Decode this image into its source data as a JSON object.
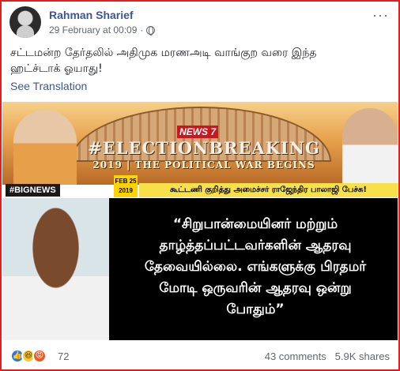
{
  "post": {
    "author": "Rahman Sharief",
    "timestamp": "29 February at 00:09",
    "separator": "·",
    "more_label": "···",
    "text_line1": "சட்டமன்ற தேர்தலில் அதிமுக மரணஅடி வாங்குற வரை இந்த",
    "text_line2": "ஹட்ச்டாக் ஓயாது!",
    "see_translation": "See Translation"
  },
  "image": {
    "channel_logo": "NEWS 7",
    "headline": "#ELECTIONBREAKING",
    "subheadline": "2019 | THE POLITICAL WAR BEGINS",
    "tag": "#BIGNEWS",
    "date_line1": "FEB 25",
    "date_line2": "2019",
    "caption": "கூட்டணி குறித்து அமைச்சர் ராஜேந்திர பாலாஜி பேச்சு!",
    "quote_line1": "“சிறுபான்மையினர் மற்றும்",
    "quote_line2": "தாழ்த்தப்பட்டவர்களின் ஆதரவு",
    "quote_line3": "தேவையில்லை. எங்களுக்கு பிரதமர்",
    "quote_line4": "மோடி ஒருவரின் ஆதரவு ஒன்று",
    "quote_line5": "போதும்”"
  },
  "footer": {
    "reaction_count": "72",
    "comments": "43 comments",
    "shares": "5.9K shares"
  },
  "icons": {
    "like": "like-icon",
    "haha": "haha-icon",
    "angry": "angry-icon",
    "globe": "globe-icon"
  },
  "colors": {
    "author_link": "#385898",
    "frame": "#e02020",
    "like_blue": "#2078f4"
  }
}
